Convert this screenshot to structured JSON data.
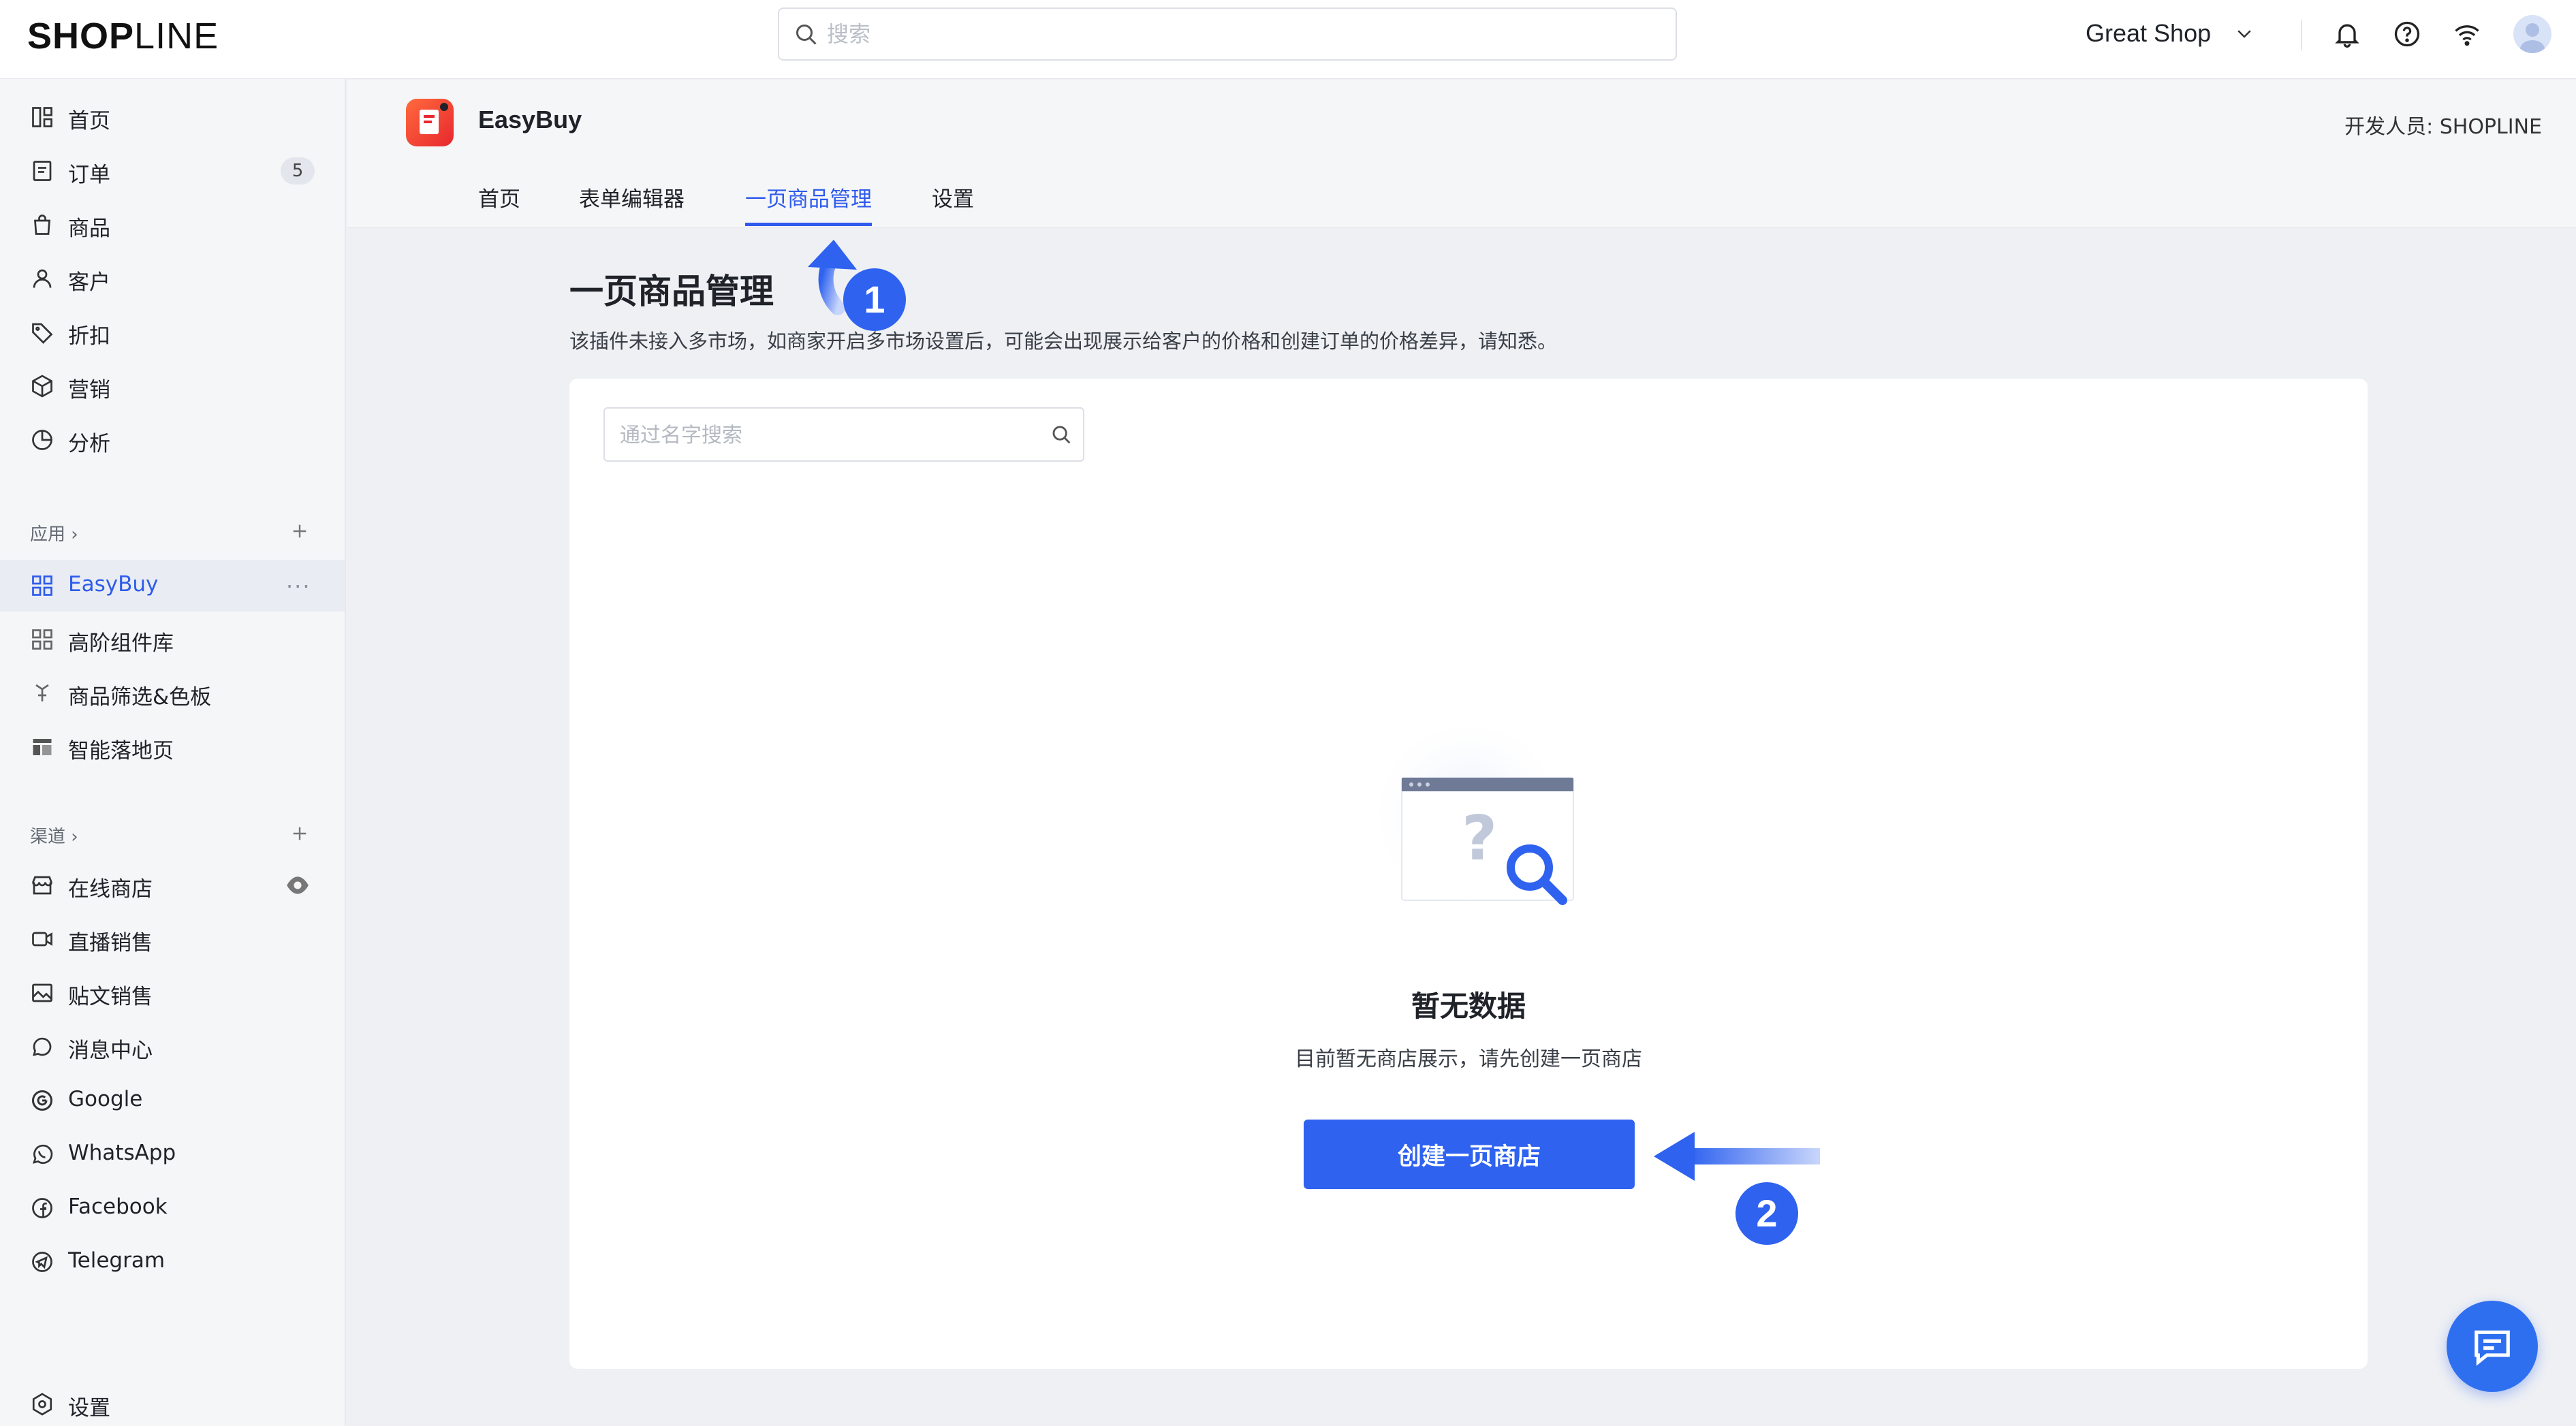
{
  "topbar": {
    "logo_bold": "SHOP",
    "logo_thin": "LINE",
    "search_placeholder": "搜索",
    "shop_name": "Great Shop"
  },
  "sidebar": {
    "main_items": [
      {
        "label": "首页",
        "icon": "dashboard-icon"
      },
      {
        "label": "订单",
        "icon": "order-icon",
        "badge": "5"
      },
      {
        "label": "商品",
        "icon": "bag-icon"
      },
      {
        "label": "客户",
        "icon": "user-icon"
      },
      {
        "label": "折扣",
        "icon": "tag-icon"
      },
      {
        "label": "营销",
        "icon": "cube-icon"
      },
      {
        "label": "分析",
        "icon": "pie-icon"
      }
    ],
    "apps_title": "应用",
    "apps": [
      {
        "label": "EasyBuy",
        "active": true
      },
      {
        "label": "高阶组件库"
      },
      {
        "label": "商品筛选&色板"
      },
      {
        "label": "智能落地页"
      }
    ],
    "channels_title": "渠道",
    "channels": [
      {
        "label": "在线商店",
        "icon": "store-icon"
      },
      {
        "label": "直播销售",
        "icon": "video-icon"
      },
      {
        "label": "贴文销售",
        "icon": "image-icon"
      },
      {
        "label": "消息中心",
        "icon": "chat-icon"
      },
      {
        "label": "Google",
        "icon": "google-icon"
      },
      {
        "label": "WhatsApp",
        "icon": "whatsapp-icon"
      },
      {
        "label": "Facebook",
        "icon": "facebook-icon"
      },
      {
        "label": "Telegram",
        "icon": "telegram-icon"
      }
    ],
    "settings_label": "设置"
  },
  "app": {
    "name": "EasyBuy",
    "developer": "开发人员: SHOPLINE",
    "tabs": [
      "首页",
      "表单编辑器",
      "一页商品管理",
      "设置"
    ],
    "active_tab": "一页商品管理"
  },
  "main": {
    "title": "一页商品管理",
    "notice": "该插件未接入多市场，如商家开启多市场设置后，可能会出现展示给客户的价格和创建订单的价格差异，请知悉。",
    "search_placeholder": "通过名字搜索",
    "empty_title": "暂无数据",
    "empty_desc": "目前暂无商店展示，请先创建一页商店",
    "create_button": "创建一页商店"
  },
  "annotations": {
    "step1": "1",
    "step2": "2"
  },
  "colors": {
    "accent": "#2e62ef",
    "active_text": "#2e5bec",
    "sidebar_bg": "#f5f6f8"
  }
}
